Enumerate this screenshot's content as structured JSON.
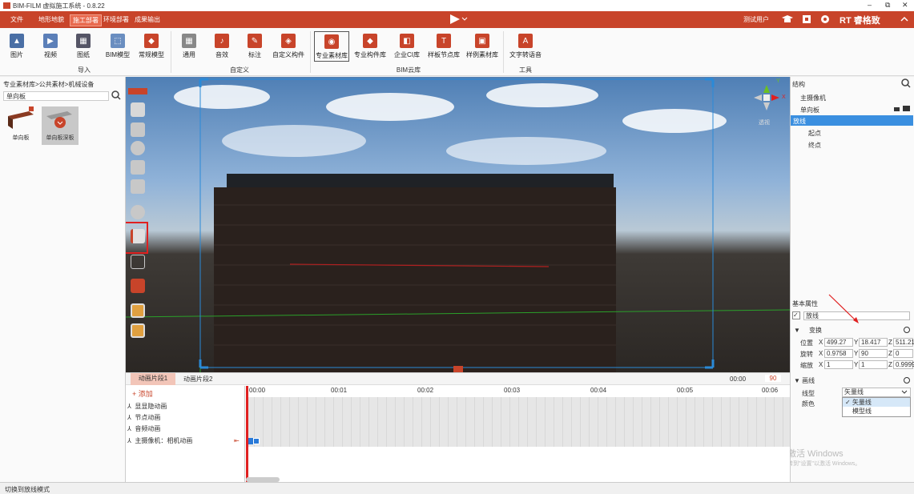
{
  "app": {
    "title": "BIM-FILM 虚拟施工系统 - 0.8.22",
    "user": "测试用户",
    "brand": "RT 睿格致"
  },
  "window_controls": {
    "minimize": "–",
    "restore": "⧉",
    "close": "✕"
  },
  "menu": [
    "文件",
    "地形地貌",
    "施工部署",
    "环境部署",
    "成果输出"
  ],
  "toolbar": {
    "import_items": [
      "图片",
      "视频",
      "图纸",
      "BIM模型",
      "常规模型"
    ],
    "import_group": "导入",
    "custom_items": [
      "通用",
      "音效",
      "标注",
      "自定义构件"
    ],
    "custom_group": "自定义",
    "cloud_items": [
      "专业素材库",
      "专业构件库",
      "企业CI库",
      "样板节点库",
      "样例素材库"
    ],
    "cloud_group": "BIM云库",
    "tool_items": [
      "文字转语音"
    ],
    "tool_group": "工具"
  },
  "left_panel": {
    "breadcrumb": "专业素材库>公共素材>机械设备",
    "search_value": "单向板",
    "assets": [
      "单向板",
      "单向板深板"
    ]
  },
  "viewport": {
    "persp_label": "透视",
    "nav_labels": [
      "Y",
      "X"
    ]
  },
  "right_panel": {
    "structure_title": "结构",
    "tree": [
      "主摄像机",
      "单向板",
      "放线",
      "起点",
      "终点"
    ],
    "basic_props_title": "基本属性",
    "name_value": "放线",
    "transform_title": "变换",
    "position_label": "位置",
    "position": {
      "x": "499.27",
      "y": "18.417",
      "z": "511.21"
    },
    "rotation_label": "旋转",
    "rotation": {
      "x": "0.9758",
      "y": "90",
      "z": "0"
    },
    "scale_label": "缩放",
    "scale": {
      "x": "1",
      "y": "1",
      "z": "0.9999"
    },
    "line_section": "画线",
    "line_type_label": "线型",
    "line_type_value": "矢量线",
    "color_label": "颜色",
    "dropdown_options": [
      "矢量线",
      "模型线"
    ],
    "watermark1": "激活 Windows",
    "watermark2": "转到\"设置\"以激活 Windows。"
  },
  "timeline": {
    "tabs": [
      "动画片段1",
      "动画片段2"
    ],
    "time": "00:00",
    "end": "90",
    "add_label": "+ 添加",
    "tracks": [
      "显显隐动画",
      "节点动画",
      "音频动画",
      "主摄像机：相机动画"
    ],
    "ticks": [
      "00:00",
      "00:01",
      "00:02",
      "00:03",
      "00:04",
      "00:05",
      "00:06"
    ]
  },
  "status": "切换到放线模式"
}
